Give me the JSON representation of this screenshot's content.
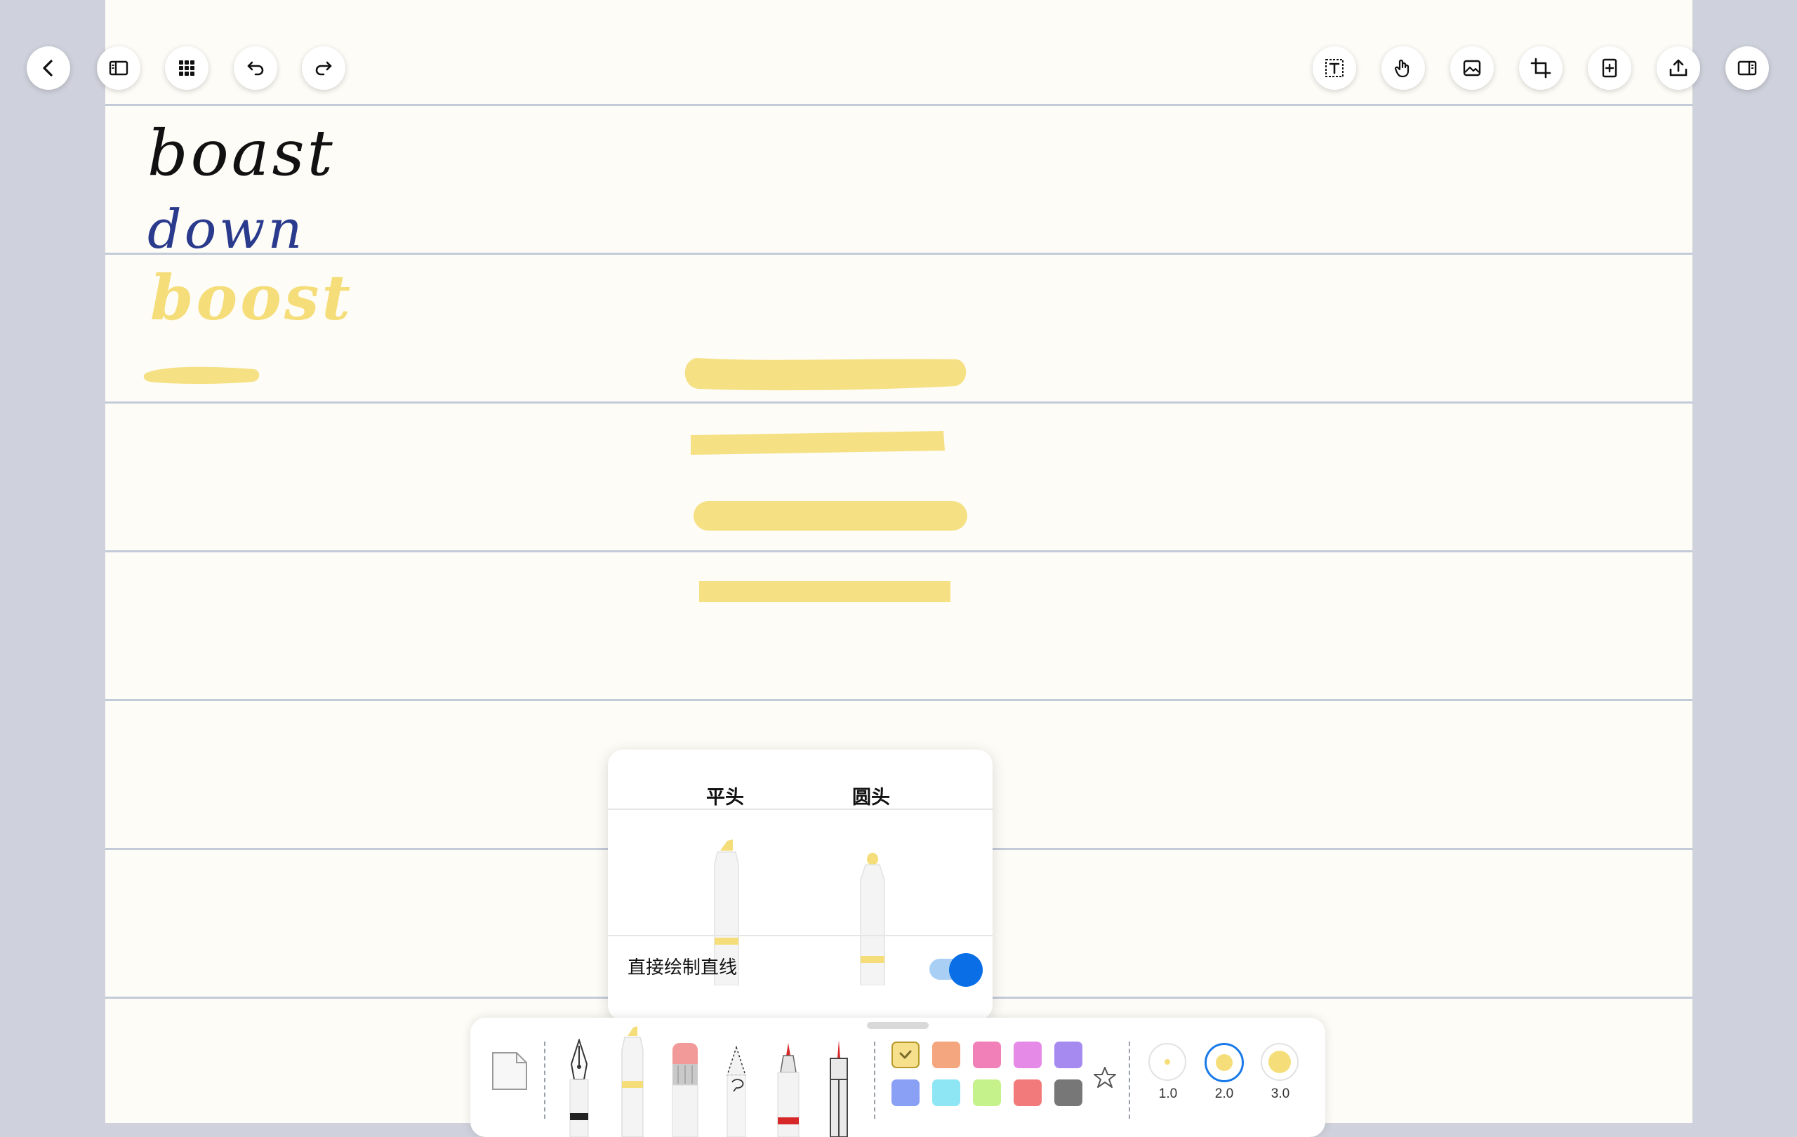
{
  "toolbar": {
    "left": [
      "back-button",
      "sidebar-button",
      "grid-button",
      "undo-button",
      "redo-button"
    ],
    "right": [
      "text-box-button",
      "hand-button",
      "image-button",
      "crop-button",
      "add-page-button",
      "export-button",
      "split-view-button"
    ]
  },
  "note": {
    "handwriting": [
      {
        "text": "boast",
        "color": "#111111"
      },
      {
        "text": "down",
        "color": "#2a3a8c"
      },
      {
        "text": "boost",
        "color": "#f5de7a"
      }
    ],
    "highlight_color": "#f5e184"
  },
  "popup": {
    "tabs": [
      {
        "label": "平头"
      },
      {
        "label": "圆头"
      }
    ],
    "option_label": "直接绘制直线",
    "option_enabled": true
  },
  "pens": [
    "page-tool",
    "fountain-pen",
    "highlighter",
    "eraser",
    "lasso",
    "marker",
    "ruler-pen"
  ],
  "colors": {
    "row1": [
      "#f7e08c",
      "#f4a67e",
      "#f280b8",
      "#e68ae8",
      "#a78af0"
    ],
    "row2": [
      "#8aa0f4",
      "#8ee6f4",
      "#c6f28c",
      "#f27a7a",
      "#777777"
    ],
    "selected": "#f7e08c"
  },
  "sizes": [
    {
      "label": "1.0",
      "selected": false
    },
    {
      "label": "2.0",
      "selected": true
    },
    {
      "label": "3.0",
      "selected": false
    }
  ]
}
